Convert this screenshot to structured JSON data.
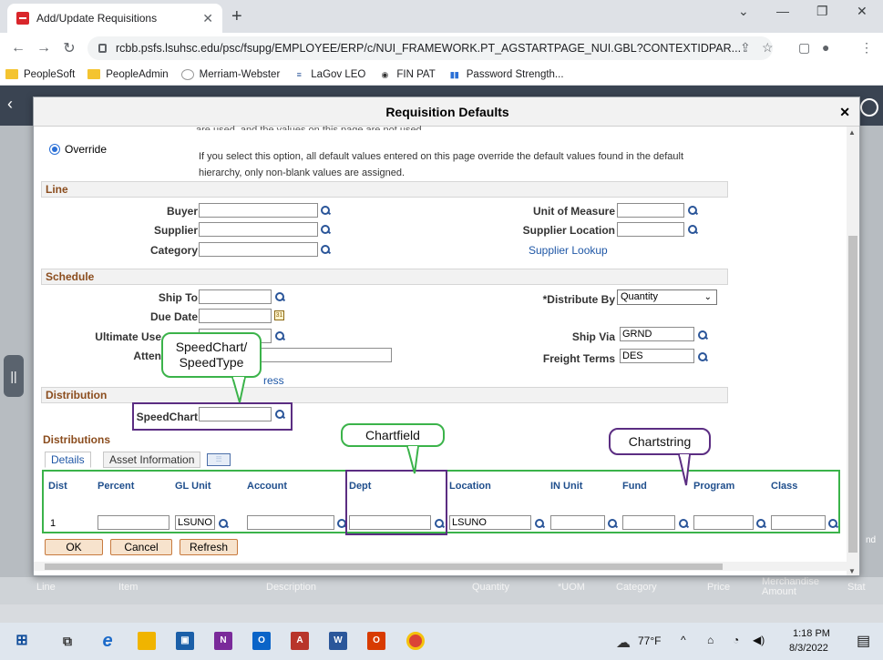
{
  "browser": {
    "tab_title": "Add/Update Requisitions",
    "url": "rcbb.psfs.lsuhsc.edu/psc/fsupg/EMPLOYEE/ERP/c/NUI_FRAMEWORK.PT_AGSTARTPAGE_NUI.GBL?CONTEXTIDPAR...",
    "bookmarks": [
      "PeopleSoft",
      "PeopleAdmin",
      "Merriam-Webster",
      "LaGov LEO",
      "FIN PAT",
      "Password Strength..."
    ]
  },
  "modal": {
    "title": "Requisition Defaults",
    "override_label": "Override",
    "override_desc": "If you select this option, all default values entered on this page override the default values found in the default hierarchy, only non-blank values are assigned.",
    "line": {
      "section": "Line",
      "buyer": "Buyer",
      "supplier": "Supplier",
      "category": "Category",
      "uom": "Unit of Measure",
      "supplier_location": "Supplier Location",
      "supplier_lookup": "Supplier Lookup"
    },
    "schedule": {
      "section": "Schedule",
      "ship_to": "Ship To",
      "due_date": "Due Date",
      "ultimate_use": "Ultimate Use",
      "attention": "Atten",
      "address_link": "ress",
      "distribute_by": "*Distribute By",
      "distribute_by_value": "Quantity",
      "ship_via": "Ship Via",
      "ship_via_value": "GRND",
      "freight_terms": "Freight Terms",
      "freight_terms_value": "DES"
    },
    "distribution": {
      "section": "Distribution",
      "speedchart": "SpeedChart"
    },
    "distributions": {
      "title": "Distributions",
      "tabs": [
        "Details",
        "Asset Information"
      ],
      "columns": [
        "Dist",
        "Percent",
        "GL Unit",
        "Account",
        "Dept",
        "Location",
        "IN Unit",
        "Fund",
        "Program",
        "Class"
      ],
      "row": {
        "dist": "1",
        "gl_unit": "LSUNO",
        "location": "LSUNO"
      }
    },
    "buttons": {
      "ok": "OK",
      "cancel": "Cancel",
      "refresh": "Refresh"
    }
  },
  "background_grid": [
    "Line",
    "Item",
    "Description",
    "Quantity",
    "*UOM",
    "Category",
    "Price",
    "Merchandise Amount",
    "Stat"
  ],
  "background_side": "nd",
  "annotations": {
    "speedchart": "SpeedChart/ SpeedType",
    "chartfield": "Chartfield",
    "chartstring": "Chartstring"
  },
  "taskbar": {
    "weather": "77°F",
    "time": "1:18 PM",
    "date": "8/3/2022"
  }
}
